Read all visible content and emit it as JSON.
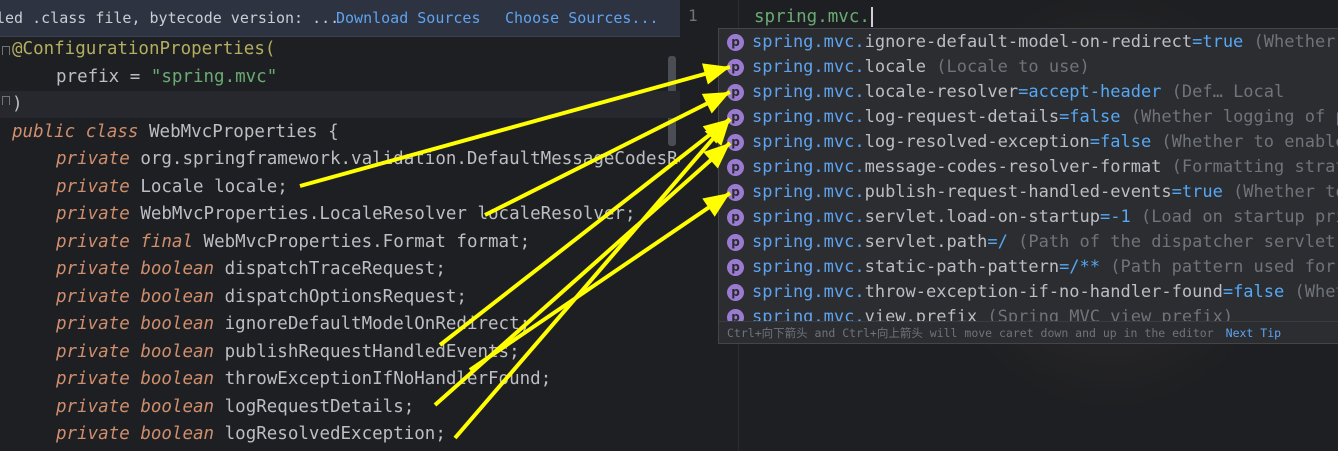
{
  "banner": {
    "text": "led .class file, bytecode version: ...",
    "download_label": "Download Sources",
    "choose_label": "Choose Sources..."
  },
  "code_lines": [
    "@ConfigurationProperties(",
    "    prefix = \"spring.mvc\"",
    ")",
    "public class WebMvcProperties {",
    "    private org.springframework.validation.DefaultMessageCodesResolver.Format messageCodesResolverFormat;",
    "    private Locale locale;",
    "    private WebMvcProperties.LocaleResolver localeResolver;",
    "    private final WebMvcProperties.Format format;",
    "    private boolean dispatchTraceRequest;",
    "    private boolean dispatchOptionsRequest;",
    "    private boolean ignoreDefaultModelOnRedirect;",
    "    private boolean publishRequestHandledEvents;",
    "    private boolean throwExceptionIfNoHandlerFound;",
    "    private boolean logRequestDetails;",
    "    private boolean logResolvedException;"
  ],
  "code": {
    "annotation": "@ConfigurationProperties(",
    "prefix_key": "prefix = ",
    "prefix_value": "\"spring.mvc\"",
    "close_paren": ")",
    "kw_public": "public",
    "kw_class": "class",
    "class_decl": "WebMvcProperties {",
    "kw_private": "private",
    "kw_final": "final",
    "kw_boolean": "boolean",
    "f1": "org.springframework.validation.DefaultMessageCodesResolver.Format messageCodesResolverFormat;",
    "f2": "Locale locale;",
    "f3": "WebMvcProperties.LocaleResolver localeResolver;",
    "f4": "WebMvcProperties.Format format;",
    "f5": "dispatchTraceRequest;",
    "f6": "dispatchOptionsRequest;",
    "f7": "ignoreDefaultModelOnRedirect;",
    "f8": "publishRequestHandledEvents;",
    "f9": "throwExceptionIfNoHandlerFound;",
    "f10": "logRequestDetails;",
    "f11": "logResolvedException;"
  },
  "editor": {
    "line_number": "1",
    "typed_text": "spring.mvc."
  },
  "completion": {
    "icon_letter": "p",
    "prefix": "spring.mvc.",
    "items": [
      {
        "name": "ignore-default-model-on-redirect",
        "value": "=true",
        "hint": " (Whether the content of the default model should be ignored"
      },
      {
        "name": "locale",
        "value": "",
        "hint": " (Locale to use)"
      },
      {
        "name": "locale-resolver",
        "value": "=accept-header",
        "hint": " (Def…   Local"
      },
      {
        "name": "log-request-details",
        "value": "=false",
        "hint": " (Whether logging of potentially sensitive request details"
      },
      {
        "name": "log-resolved-exception",
        "value": "=false",
        "hint": " (Whether to enable warn logging"
      },
      {
        "name": "message-codes-resolver-format",
        "value": "",
        "hint": " (Formatting strategy for message codes"
      },
      {
        "name": "publish-request-handled-events",
        "value": "=true",
        "hint": " (Whether to publish a ServletRequestHandledEvent"
      },
      {
        "name": "servlet.load-on-startup",
        "value": "=-1",
        "hint": " (Load on startup priority of the dispatcher servlet"
      },
      {
        "name": "servlet.path",
        "value": "=/",
        "hint": " (Path of the dispatcher servlet"
      },
      {
        "name": "static-path-pattern",
        "value": "=/**",
        "hint": " (Path pattern used for static resources"
      },
      {
        "name": "throw-exception-if-no-handler-found",
        "value": "=false",
        "hint": " (Whether a NoHandlerFoundException"
      },
      {
        "name": "view.prefix",
        "value": "",
        "hint": " (Spring MVC view prefix)"
      }
    ],
    "footer_text": "Ctrl+向下箭头 and Ctrl+向上箭头 will move caret down and up in the editor",
    "next_tip": "Next Tip"
  },
  "colors": {
    "annotation_arrow": "#ffff00",
    "keyword": "#cf8e6d",
    "string": "#6aab73",
    "completion_prefix": "#5fa3f0",
    "property_icon": "#9b7bd1"
  }
}
